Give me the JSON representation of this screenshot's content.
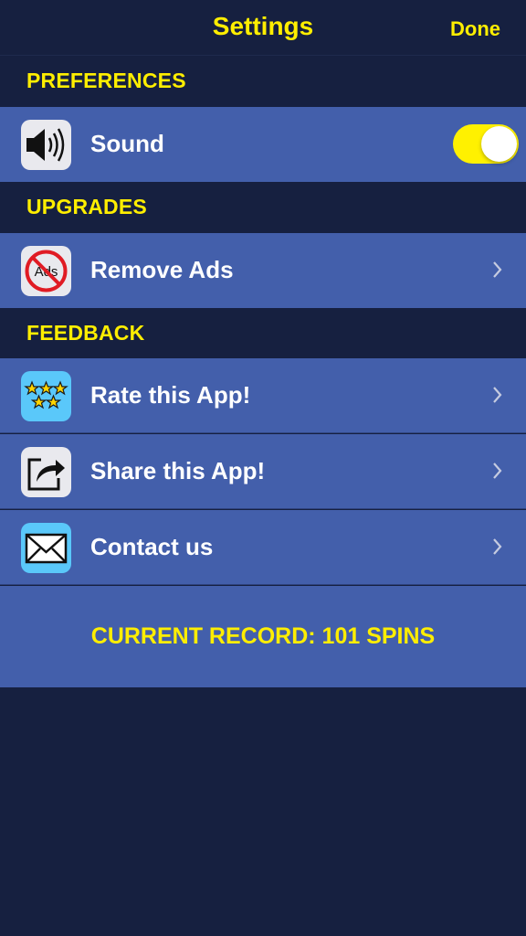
{
  "navbar": {
    "title": "Settings",
    "done_label": "Done"
  },
  "sections": {
    "preferences": "PREFERENCES",
    "upgrades": "UPGRADES",
    "feedback": "FEEDBACK"
  },
  "rows": {
    "sound": {
      "label": "Sound",
      "icon": "speaker-icon",
      "toggle_on": true
    },
    "remove_ads": {
      "label": "Remove Ads",
      "icon": "no-ads-icon",
      "icon_text": "Ads"
    },
    "rate": {
      "label": "Rate this App!",
      "icon": "stars-icon"
    },
    "share": {
      "label": "Share this App!",
      "icon": "share-icon"
    },
    "contact": {
      "label": "Contact us",
      "icon": "envelope-icon"
    }
  },
  "record": {
    "text": "CURRENT RECORD: 101 SPINS"
  },
  "colors": {
    "background": "#162040",
    "row": "#435fab",
    "accent": "#ffee00",
    "toggle_on": "#fff100",
    "icon_blue": "#5ac8fa"
  }
}
